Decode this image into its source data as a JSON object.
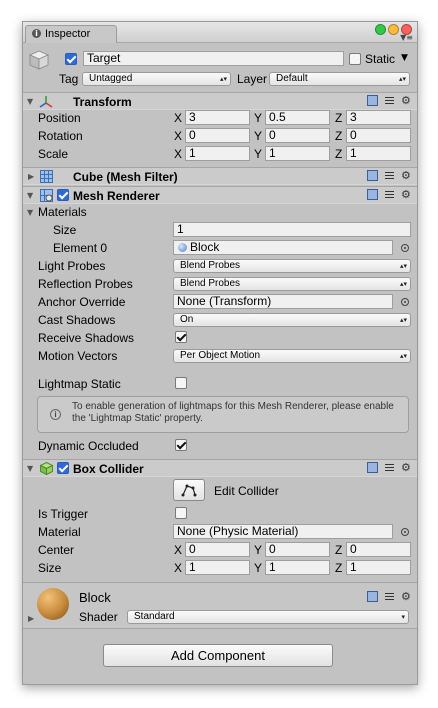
{
  "window": {
    "tab_label": "Inspector",
    "colors": {
      "close": "#fc605c",
      "minimize": "#fdbc40",
      "maximize": "#34c84a"
    }
  },
  "object": {
    "name": "Target",
    "active": true,
    "static_label": "Static",
    "static_checked": false,
    "tag_label": "Tag",
    "tag_value": "Untagged",
    "layer_label": "Layer",
    "layer_value": "Default"
  },
  "transform": {
    "title": "Transform",
    "rows": [
      {
        "label": "Position",
        "x": "3",
        "y": "0.5",
        "z": "3"
      },
      {
        "label": "Rotation",
        "x": "0",
        "y": "0",
        "z": "0"
      },
      {
        "label": "Scale",
        "x": "1",
        "y": "1",
        "z": "1"
      }
    ],
    "axis": {
      "x": "X",
      "y": "Y",
      "z": "Z"
    }
  },
  "mesh_filter": {
    "title": "Cube (Mesh Filter)"
  },
  "mesh_renderer": {
    "title": "Mesh Renderer",
    "enabled": true,
    "materials_label": "Materials",
    "size_label": "Size",
    "size_value": "1",
    "element0_label": "Element 0",
    "element0_value": "Block",
    "light_probes_label": "Light Probes",
    "light_probes_value": "Blend Probes",
    "reflection_probes_label": "Reflection Probes",
    "reflection_probes_value": "Blend Probes",
    "anchor_override_label": "Anchor Override",
    "anchor_override_value": "None (Transform)",
    "cast_shadows_label": "Cast Shadows",
    "cast_shadows_value": "On",
    "receive_shadows_label": "Receive Shadows",
    "receive_shadows_checked": true,
    "motion_vectors_label": "Motion Vectors",
    "motion_vectors_value": "Per Object Motion",
    "lightmap_static_label": "Lightmap Static",
    "lightmap_static_checked": false,
    "help_text": "To enable generation of lightmaps for this Mesh Renderer, please enable the 'Lightmap Static' property.",
    "dynamic_occluded_label": "Dynamic Occluded",
    "dynamic_occluded_checked": true
  },
  "box_collider": {
    "title": "Box Collider",
    "enabled": true,
    "edit_label": "Edit Collider",
    "is_trigger_label": "Is Trigger",
    "is_trigger_checked": false,
    "material_label": "Material",
    "material_value": "None (Physic Material)",
    "center_label": "Center",
    "center": {
      "x": "0",
      "y": "0",
      "z": "0"
    },
    "size_label": "Size",
    "size": {
      "x": "1",
      "y": "1",
      "z": "1"
    }
  },
  "material": {
    "name": "Block",
    "shader_label": "Shader",
    "shader_value": "Standard"
  },
  "add_component_label": "Add Component"
}
